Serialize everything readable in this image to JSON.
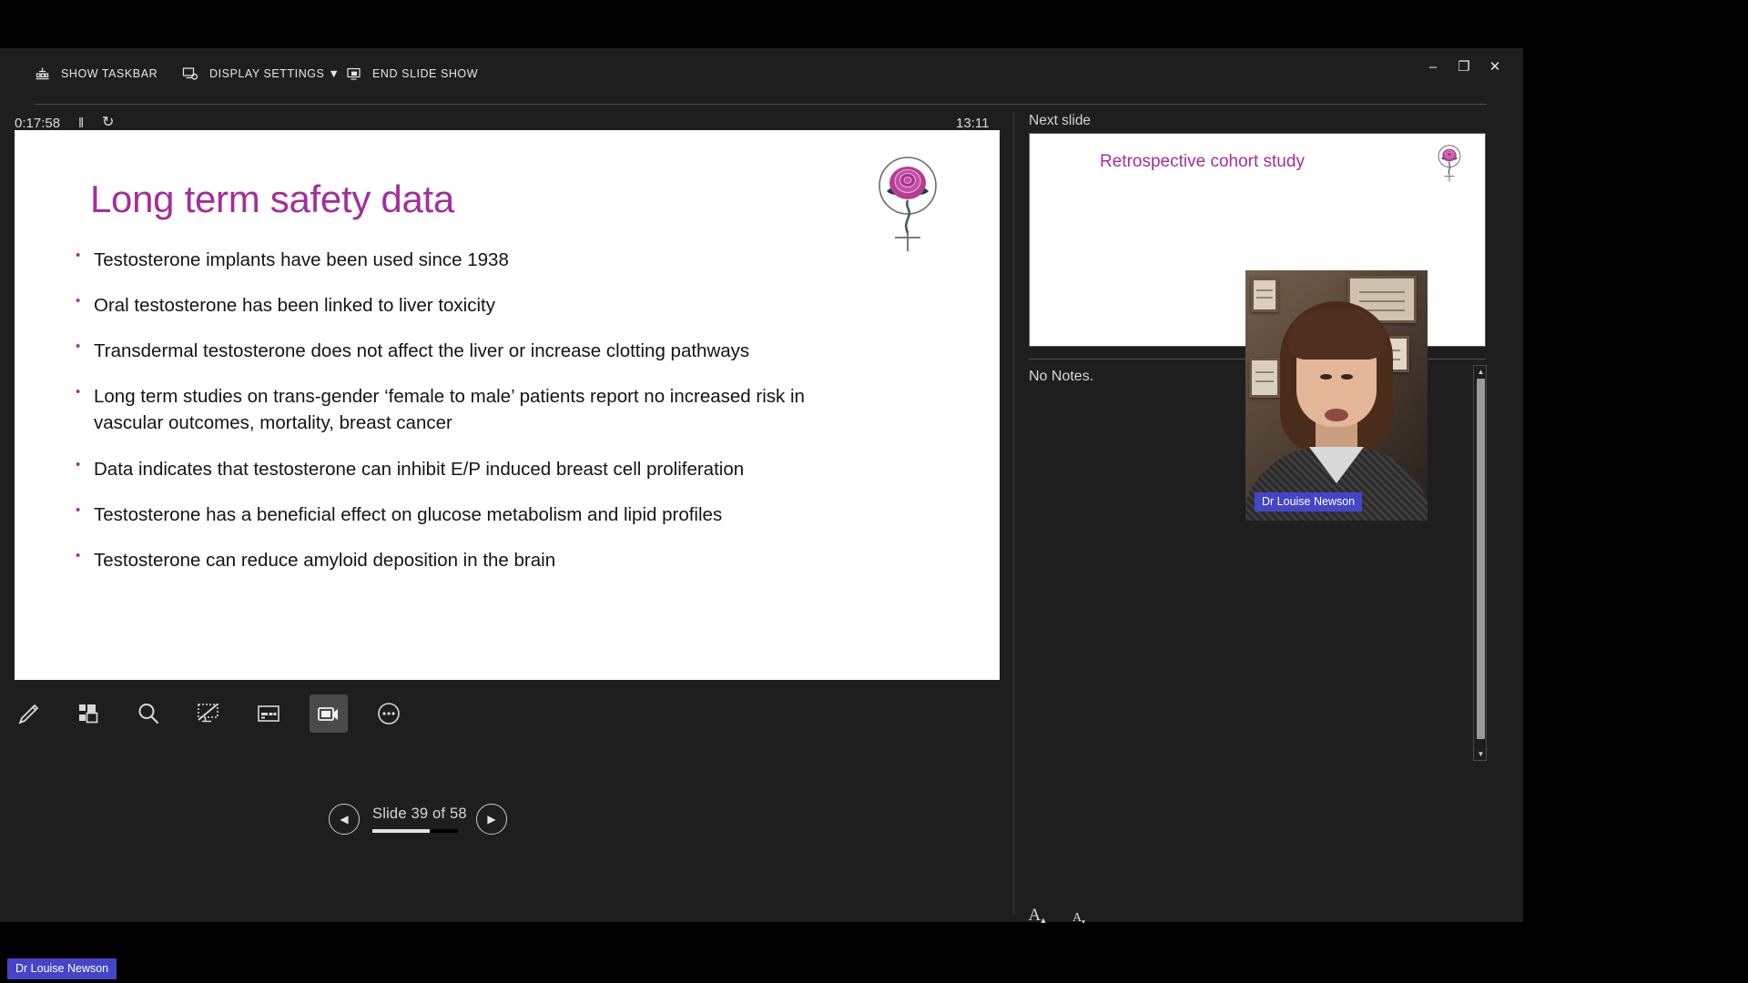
{
  "app": {
    "name": "PowerPoint Presenter View"
  },
  "top_bar": {
    "commands": [
      {
        "id": "show-taskbar",
        "label": "SHOW TASKBAR",
        "icon": "taskbar-icon"
      },
      {
        "id": "display-settings",
        "label": "DISPLAY SETTINGS ▼",
        "icon": "display-settings-icon"
      },
      {
        "id": "end-show",
        "label": "END SLIDE SHOW",
        "icon": "end-show-icon"
      }
    ],
    "window_buttons": {
      "minimize": "–",
      "maximize": "❐",
      "close": "✕"
    }
  },
  "timer": {
    "elapsed": "0:17:58",
    "pause_icon": "‖",
    "restart_icon": "↻",
    "clock": "13:11"
  },
  "slide": {
    "title": "Long term safety data",
    "bullets": [
      "Testosterone implants have been used since 1938",
      "Oral testosterone has been linked to liver toxicity",
      "Transdermal testosterone does not affect the liver or increase clotting pathways",
      "Long term studies on trans-gender ‘female to male’ patients report no increased risk in vascular outcomes, mortality, breast cancer",
      "Data indicates that testosterone can inhibit E/P induced breast cell proliferation",
      "Testosterone has a beneficial effect on glucose metabolism and lipid profiles",
      "Testosterone can reduce amyloid deposition in the brain"
    ],
    "title_color": "#a32f9b",
    "bullet_color": "#a32f9b",
    "logo": "rose-venus-logo"
  },
  "tools": [
    {
      "id": "pen",
      "name": "pen-icon",
      "active": false
    },
    {
      "id": "all-slides",
      "name": "all-slides-icon",
      "active": false
    },
    {
      "id": "zoom",
      "name": "magnifier-icon",
      "active": false
    },
    {
      "id": "black-screen",
      "name": "black-screen-icon",
      "active": false
    },
    {
      "id": "subtitles",
      "name": "subtitles-icon",
      "active": false
    },
    {
      "id": "camera",
      "name": "camera-icon",
      "active": true
    },
    {
      "id": "more",
      "name": "more-options-icon",
      "active": false
    }
  ],
  "navigation": {
    "previous_label": "◀",
    "next_label": "▶",
    "counter": "Slide 39 of 58",
    "current_slide": 39,
    "total_slides": 58,
    "progress_percent": 67
  },
  "next_slide": {
    "label": "Next slide",
    "title": "Retrospective cohort study",
    "logo": "rose-venus-logo"
  },
  "notes": {
    "text": "No Notes.",
    "font_bigger_label": "A",
    "font_smaller_label": "A"
  },
  "webcam": {
    "participant_name": "Dr Louise Newson",
    "name_badge_color": "#4545c9"
  },
  "desktop": {
    "taskbar_name": "Dr Louise Newson"
  }
}
